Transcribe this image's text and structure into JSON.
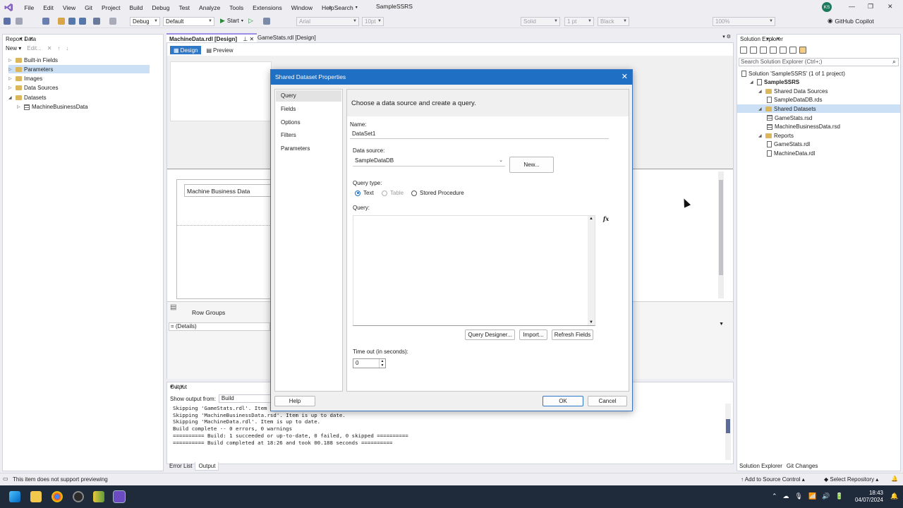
{
  "menubar": {
    "items": [
      "File",
      "Edit",
      "View",
      "Git",
      "Project",
      "Build",
      "Debug",
      "Test",
      "Analyze",
      "Tools",
      "Extensions",
      "Window",
      "Help"
    ],
    "search_label": "Search",
    "solution_name": "SampleSSRS",
    "avatar_initials": "KS"
  },
  "toolbar": {
    "config": "Debug",
    "platform": "Default",
    "start_label": "Start",
    "font": "Arial",
    "font_size": "10pt",
    "border_style": "Solid",
    "border_width": "1 pt",
    "border_color": "Black",
    "zoom": "100%",
    "copilot_label": "GitHub Copilot"
  },
  "report_data": {
    "title": "Report Data",
    "new_label": "New",
    "edit_label": "Edit...",
    "items": [
      {
        "label": "Built-in Fields",
        "level": 0,
        "expanded": false
      },
      {
        "label": "Parameters",
        "level": 0,
        "expanded": false,
        "selected": true
      },
      {
        "label": "Images",
        "level": 0,
        "expanded": false
      },
      {
        "label": "Data Sources",
        "level": 0,
        "expanded": false
      },
      {
        "label": "Datasets",
        "level": 0,
        "expanded": true
      },
      {
        "label": "MachineBusinessData",
        "level": 1,
        "expanded": false
      }
    ]
  },
  "doc": {
    "tabs": [
      "MachineData.rdl [Design]",
      "GameStats.rdl [Design]"
    ],
    "design_label": "Design",
    "preview_label": "Preview",
    "textbox_text": "Machine Business Data",
    "row_groups_label": "Row Groups",
    "details_label": "= (Details)"
  },
  "output": {
    "title": "Output",
    "show_from_label": "Show output from:",
    "show_from_value": "Build",
    "lines": [
      "Skipping 'GameStats.rdl'. Item is up to date.",
      "Skipping 'MachineBusinessData.rsd'. Item is up to date.",
      "Skipping 'MachineData.rdl'. Item is up to date.",
      "Build complete -- 0 errors, 0 warnings",
      "========== Build: 1 succeeded or up-to-date, 0 failed, 0 skipped ==========",
      "========== Build completed at 18:26 and took 00.188 seconds =========="
    ],
    "tabs": [
      "Error List",
      "Output"
    ]
  },
  "solution_explorer": {
    "title": "Solution Explorer",
    "search_placeholder": "Search Solution Explorer (Ctrl+;)",
    "items": [
      {
        "label": "Solution 'SampleSSRS' (1 of 1 project)",
        "level": 0,
        "kind": "solution"
      },
      {
        "label": "SampleSSRS",
        "level": 1,
        "kind": "project"
      },
      {
        "label": "Shared Data Sources",
        "level": 2,
        "kind": "folder"
      },
      {
        "label": "SampleDataDB.rds",
        "level": 3,
        "kind": "file"
      },
      {
        "label": "Shared Datasets",
        "level": 2,
        "kind": "folder",
        "selected": true
      },
      {
        "label": "GameStats.rsd",
        "level": 3,
        "kind": "grid"
      },
      {
        "label": "MachineBusinessData.rsd",
        "level": 3,
        "kind": "grid"
      },
      {
        "label": "Reports",
        "level": 2,
        "kind": "folder"
      },
      {
        "label": "GameStats.rdl",
        "level": 3,
        "kind": "file"
      },
      {
        "label": "MachineData.rdl",
        "level": 3,
        "kind": "file"
      }
    ],
    "tabs": [
      "Solution Explorer",
      "Git Changes"
    ]
  },
  "statusbar": {
    "message": "This item does not support previewing",
    "source_control": "Add to Source Control",
    "repository": "Select Repository"
  },
  "taskbar": {
    "time": "18:43",
    "date": "04/07/2024"
  },
  "dialog": {
    "title": "Shared Dataset Properties",
    "nav": [
      "Query",
      "Fields",
      "Options",
      "Filters",
      "Parameters"
    ],
    "heading": "Choose a data source and create a query.",
    "name_label": "Name:",
    "name_value": "DataSet1",
    "datasource_label": "Data source:",
    "datasource_value": "SampleDataDB",
    "new_button": "New...",
    "query_type_label": "Query type:",
    "query_types": [
      "Text",
      "Table",
      "Stored Procedure"
    ],
    "query_label": "Query:",
    "fx_label": "fx",
    "query_designer_button": "Query Designer...",
    "import_button": "Import...",
    "refresh_button": "Refresh Fields",
    "timeout_label": "Time out (in seconds):",
    "timeout_value": "0",
    "help_button": "Help",
    "ok_button": "OK",
    "cancel_button": "Cancel"
  }
}
